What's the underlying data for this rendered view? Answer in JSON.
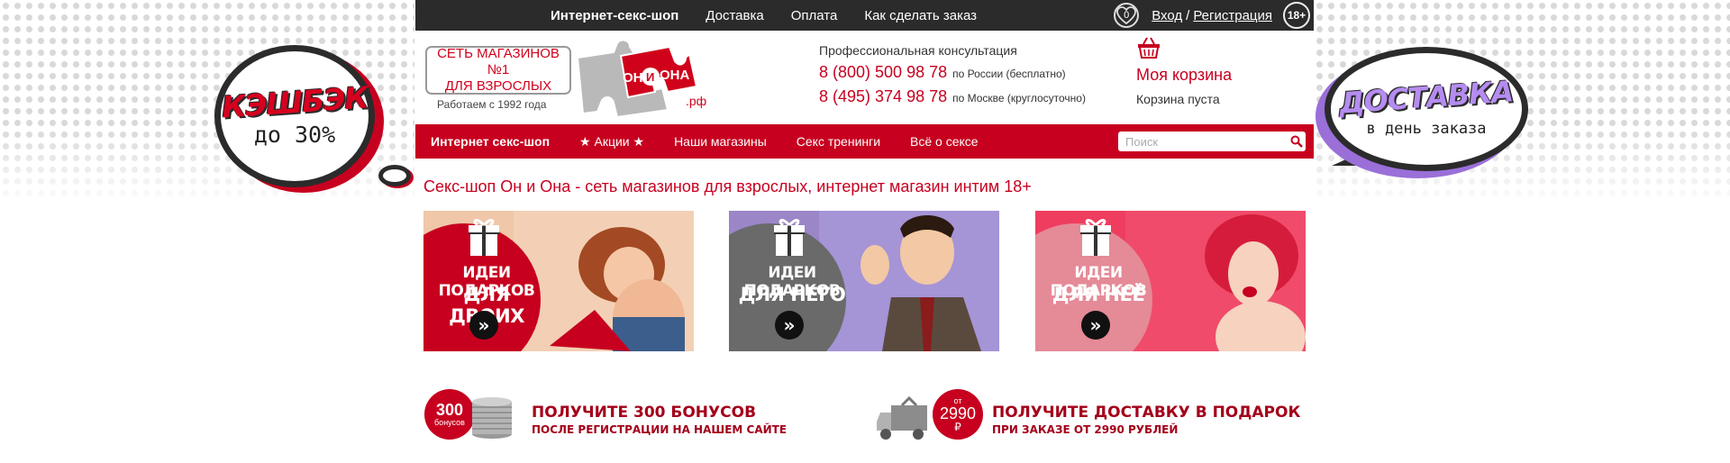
{
  "colors": {
    "brand_red": "#c7001f",
    "dark_bar": "#2b2b2b",
    "lilac": "#b58cf0"
  },
  "left_bubble": {
    "title": "КЭШБЭК",
    "subtitle": "до 30%"
  },
  "right_bubble": {
    "title": "ДОСТАВКА",
    "subtitle": "в день заказа"
  },
  "topbar": {
    "links": [
      "Интернет-секс-шоп",
      "Доставка",
      "Оплата",
      "Как сделать заказ"
    ],
    "favorites_count": "0",
    "login": "Вход",
    "separator": "/",
    "register": "Регистрация",
    "age_badge": "18+"
  },
  "logo": {
    "line1": "СЕТЬ МАГАЗИНОВ №1",
    "line2": "ДЛЯ ВЗРОСЛЫХ",
    "since": "Работаем с 1992 года",
    "brand_on": "ОН",
    "brand_i": "И",
    "brand_ona": "ОНА",
    "domain": ".рф"
  },
  "contacts": {
    "caption": "Профессиональная консультация",
    "phones": [
      {
        "number": "8 (800) 500 98 78",
        "note": "по России (бесплатно)"
      },
      {
        "number": "8 (495) 374 98 78",
        "note": "по Москве (круглосуточно)"
      }
    ]
  },
  "cart": {
    "icon": "basket-icon",
    "title": "Моя корзина",
    "status": "Корзина пуста"
  },
  "mainnav": {
    "items": [
      "Интернет секс-шоп",
      "★ Акции ★",
      "Наши магазины",
      "Секс тренинги",
      "Всё о сексе"
    ],
    "search_placeholder": "Поиск"
  },
  "page_title": "Секс-шоп Он и Она - сеть магазинов для взрослых, интернет магазин интим 18+",
  "banners": [
    {
      "line1": "ИДЕИ ПОДАРКОВ",
      "line2": "ДЛЯ ДВОИХ",
      "bg": "#f0c7a8",
      "circle": "#c7001f",
      "arrow": "»"
    },
    {
      "line1": "ИДЕИ ПОДАРКОВ",
      "line2": "ДЛЯ НЕГО",
      "bg": "#9b86c8",
      "circle": "#6a6a6a",
      "arrow": "»"
    },
    {
      "line1": "ИДЕИ ПОДАРКОВ",
      "line2": "ДЛЯ НЕЁ",
      "bg": "#ee3d5e",
      "circle": "#e58a97",
      "arrow": "»"
    }
  ],
  "promos": [
    {
      "badge_value": "300",
      "badge_label": "бонусов",
      "title": "ПОЛУЧИТЕ 300 БОНУСОВ",
      "subtitle": "ПОСЛЕ РЕГИСТРАЦИИ НА НАШЕМ САЙТЕ"
    },
    {
      "badge_top": "от",
      "badge_value": "2990",
      "badge_currency": "₽",
      "title": "ПОЛУЧИТЕ ДОСТАВКУ В ПОДАРОК",
      "subtitle": "ПРИ ЗАКАЗЕ ОТ 2990 РУБЛЕЙ"
    }
  ]
}
